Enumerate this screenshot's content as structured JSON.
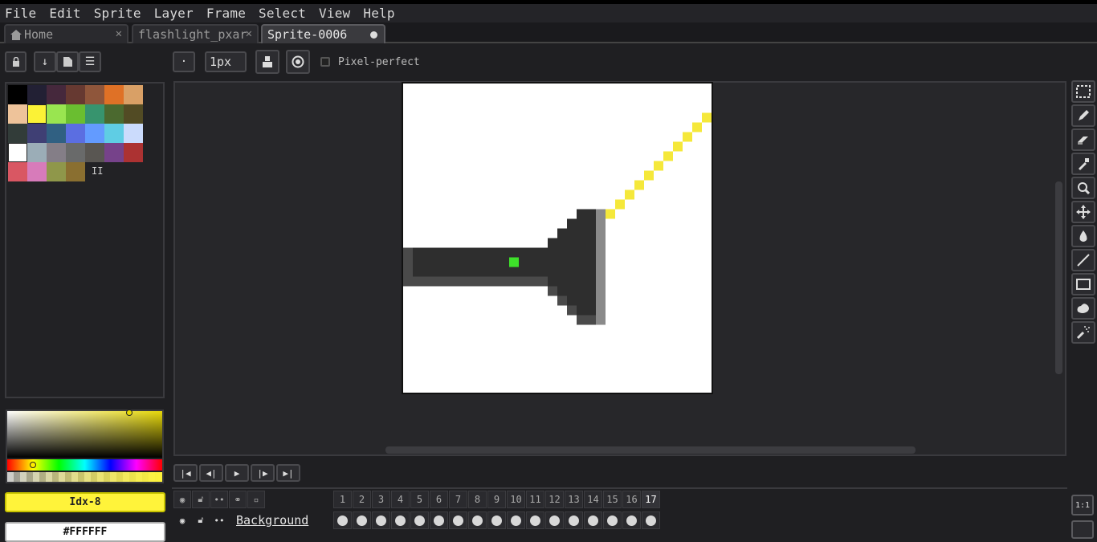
{
  "menu": [
    "File",
    "Edit",
    "Sprite",
    "Layer",
    "Frame",
    "Select",
    "View",
    "Help"
  ],
  "tabs": [
    {
      "label": "Home",
      "icon": "home-icon"
    },
    {
      "label": "flashlight_pxar",
      "icon": "close-icon"
    },
    {
      "label": "Sprite-0006",
      "icon": "modified-dot"
    }
  ],
  "toolbar": {
    "brush_size": "1px",
    "pixel_perfect_label": "Pixel-perfect"
  },
  "palette": {
    "colors": [
      "#000000",
      "#222034",
      "#45283c",
      "#663931",
      "#8f563b",
      "#df7126",
      "#d9a066",
      "#eec39a",
      "#fbf236",
      "#99e550",
      "#6abe30",
      "#37946e",
      "#4b692f",
      "#524b24",
      "#323c39",
      "#3f3f74",
      "#306082",
      "#5b6ee1",
      "#639bff",
      "#5fcde4",
      "#cbdbfc",
      "#ffffff",
      "#9badb7",
      "#847e87",
      "#696a6a",
      "#595652",
      "#76428a",
      "#ac3232",
      "#d95763",
      "#d77bba",
      "#8f974a",
      "#8a6f30"
    ]
  },
  "colors": {
    "foreground_label": "Idx-8",
    "foreground_hex": "#fff33a",
    "background_label": "#FFFFFF",
    "background_hex": "#ffffff"
  },
  "timeline": {
    "layer_name": "Background",
    "frames": [
      "1",
      "2",
      "3",
      "4",
      "5",
      "6",
      "7",
      "8",
      "9",
      "10",
      "11",
      "12",
      "13",
      "14",
      "15",
      "16",
      "17"
    ],
    "active_frame": "17"
  },
  "zoom_button": "1:1"
}
